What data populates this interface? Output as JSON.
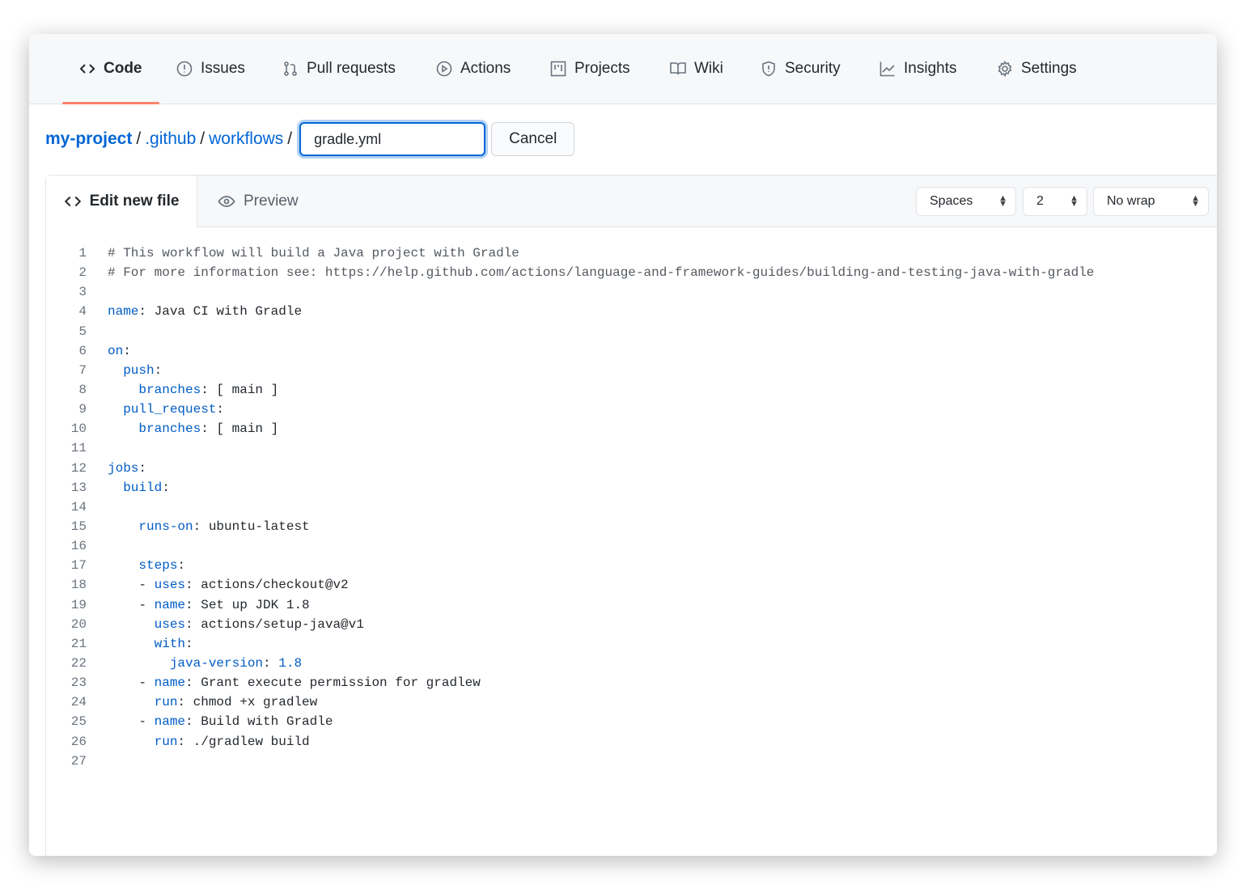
{
  "nav": {
    "tabs": [
      {
        "label": "Code",
        "icon": "code-icon",
        "selected": true
      },
      {
        "label": "Issues",
        "icon": "issue-icon"
      },
      {
        "label": "Pull requests",
        "icon": "pull-request-icon"
      },
      {
        "label": "Actions",
        "icon": "play-icon"
      },
      {
        "label": "Projects",
        "icon": "project-icon"
      },
      {
        "label": "Wiki",
        "icon": "book-icon"
      },
      {
        "label": "Security",
        "icon": "shield-icon"
      },
      {
        "label": "Insights",
        "icon": "graph-icon"
      },
      {
        "label": "Settings",
        "icon": "gear-icon"
      }
    ]
  },
  "breadcrumb": {
    "repo": "my-project",
    "dir1": ".github",
    "dir2": "workflows",
    "sep": "/"
  },
  "filename": {
    "value": "gradle.yml"
  },
  "cancel_label": "Cancel",
  "editor": {
    "edit_tab": "Edit new file",
    "preview_tab": "Preview",
    "indent_mode": "Spaces",
    "indent_size": "2",
    "wrap_mode": "No wrap"
  },
  "colors": {
    "accent": "#0366d6",
    "tab_underline": "#f9826c",
    "key": "#005cc5"
  },
  "code": [
    [
      [
        "c",
        "# This workflow will build a Java project with Gradle"
      ]
    ],
    [
      [
        "c",
        "# For more information see: https://help.github.com/actions/language-and-framework-guides/building-and-testing-java-with-gradle"
      ]
    ],
    [],
    [
      [
        "k",
        "name"
      ],
      [
        "p",
        ": Java CI with Gradle"
      ]
    ],
    [],
    [
      [
        "k",
        "on"
      ],
      [
        "p",
        ":"
      ]
    ],
    [
      [
        "p",
        "  "
      ],
      [
        "k",
        "push"
      ],
      [
        "p",
        ":"
      ]
    ],
    [
      [
        "p",
        "    "
      ],
      [
        "k",
        "branches"
      ],
      [
        "p",
        ": [ main ]"
      ]
    ],
    [
      [
        "p",
        "  "
      ],
      [
        "k",
        "pull_request"
      ],
      [
        "p",
        ":"
      ]
    ],
    [
      [
        "p",
        "    "
      ],
      [
        "k",
        "branches"
      ],
      [
        "p",
        ": [ main ]"
      ]
    ],
    [],
    [
      [
        "k",
        "jobs"
      ],
      [
        "p",
        ":"
      ]
    ],
    [
      [
        "p",
        "  "
      ],
      [
        "k",
        "build"
      ],
      [
        "p",
        ":"
      ]
    ],
    [],
    [
      [
        "p",
        "    "
      ],
      [
        "k",
        "runs-on"
      ],
      [
        "p",
        ": ubuntu-latest"
      ]
    ],
    [],
    [
      [
        "p",
        "    "
      ],
      [
        "k",
        "steps"
      ],
      [
        "p",
        ":"
      ]
    ],
    [
      [
        "p",
        "    - "
      ],
      [
        "k",
        "uses"
      ],
      [
        "p",
        ": actions/checkout@v2"
      ]
    ],
    [
      [
        "p",
        "    - "
      ],
      [
        "k",
        "name"
      ],
      [
        "p",
        ": Set up JDK 1.8"
      ]
    ],
    [
      [
        "p",
        "      "
      ],
      [
        "k",
        "uses"
      ],
      [
        "p",
        ": actions/setup-java@v1"
      ]
    ],
    [
      [
        "p",
        "      "
      ],
      [
        "k",
        "with"
      ],
      [
        "p",
        ":"
      ]
    ],
    [
      [
        "p",
        "        "
      ],
      [
        "k",
        "java-version"
      ],
      [
        "p",
        ": "
      ],
      [
        "n",
        "1.8"
      ]
    ],
    [
      [
        "p",
        "    - "
      ],
      [
        "k",
        "name"
      ],
      [
        "p",
        ": Grant execute permission for gradlew"
      ]
    ],
    [
      [
        "p",
        "      "
      ],
      [
        "k",
        "run"
      ],
      [
        "p",
        ": chmod +x gradlew"
      ]
    ],
    [
      [
        "p",
        "    - "
      ],
      [
        "k",
        "name"
      ],
      [
        "p",
        ": Build with Gradle"
      ]
    ],
    [
      [
        "p",
        "      "
      ],
      [
        "k",
        "run"
      ],
      [
        "p",
        ": ./gradlew build"
      ]
    ],
    []
  ]
}
